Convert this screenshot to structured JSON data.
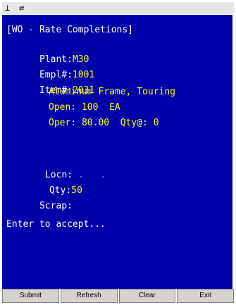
{
  "titlebar": {
    "icon1": "⊥",
    "icon2": "⇄"
  },
  "screen": {
    "title": "[WO - Rate Completions]",
    "plant_label": "Plant:",
    "plant_value": "M30",
    "empl_label": "Empl#:",
    "empl_value": "1001",
    "item_label": "Item#:",
    "item_value": "2031",
    "item_desc": "Aluminum Frame, Touring",
    "open_text": "Open: 100  EA",
    "oper_text": "Oper: 80.00  Qty@: 0",
    "locn_label": "Locn:",
    "locn_dots": ".   .",
    "qty_label": "Qty:",
    "qty_value": "50",
    "scrap_label": "Scrap:",
    "prompt": "Enter to accept..."
  },
  "buttons": {
    "submit": "Submit",
    "refresh": "Refresh",
    "clear": "Clear",
    "exit": "Exit"
  },
  "colors": {
    "background": "#0000a8",
    "label": "#ffffff",
    "value": "#ffff00"
  }
}
